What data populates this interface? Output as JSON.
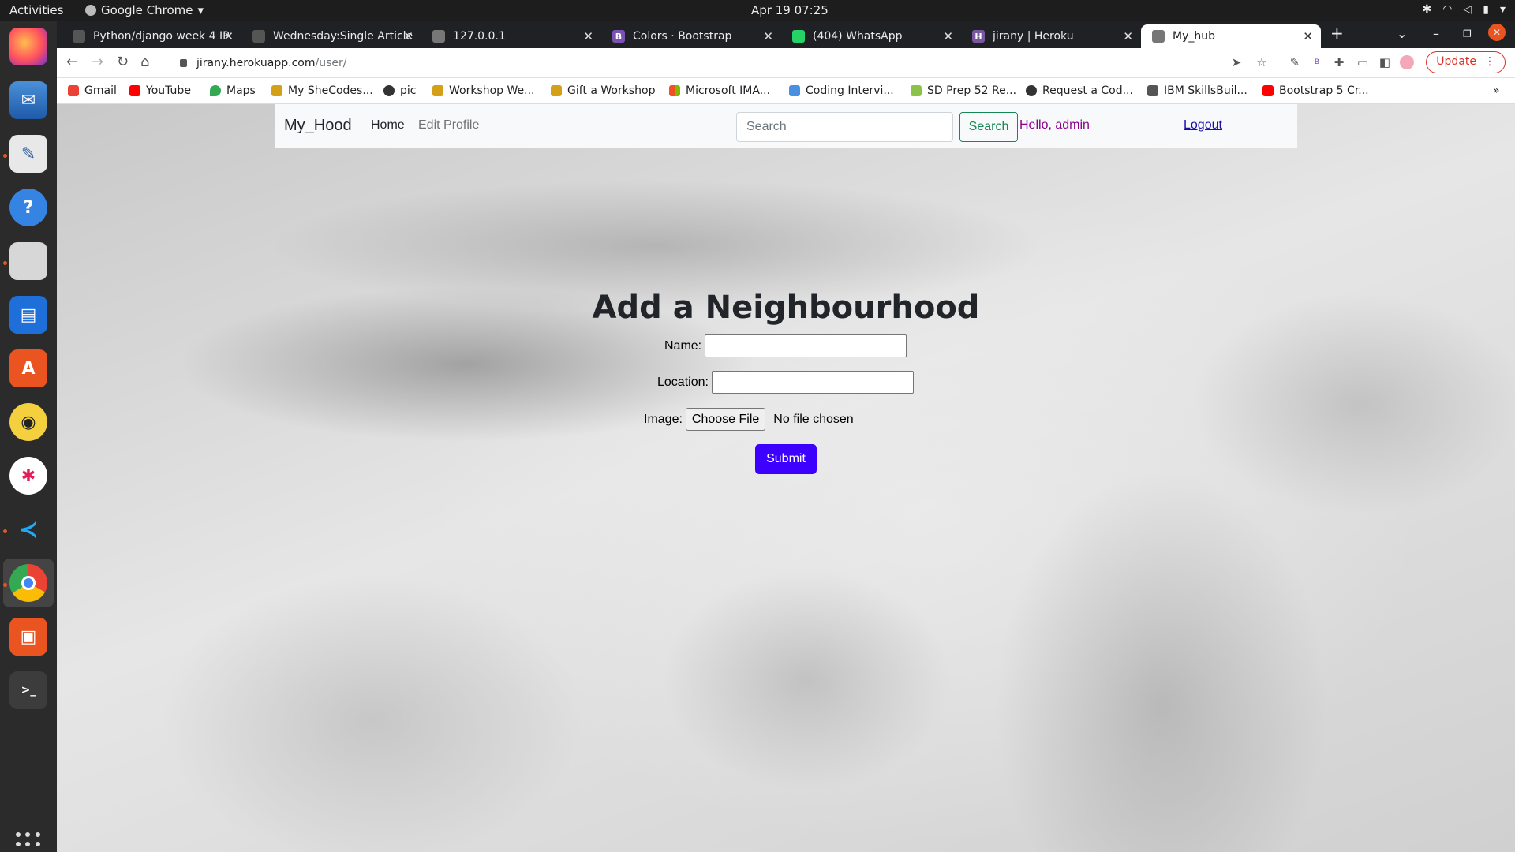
{
  "topbar": {
    "activities": "Activities",
    "app_name": "Google Chrome",
    "datetime": "Apr 19  07:25"
  },
  "dock": {
    "items": [
      "firefox-icon",
      "thunderbird-icon",
      "text-editor-icon",
      "help-icon",
      "files-icon",
      "writer-icon",
      "software-center-icon",
      "rhythmbox-icon",
      "slack-icon",
      "vscode-icon",
      "chrome-icon",
      "impress-icon",
      "terminal-icon"
    ]
  },
  "tabs": [
    {
      "title": "Python/django week 4 IP",
      "favicon_color": "#555555"
    },
    {
      "title": "Wednesday:Single Article",
      "favicon_color": "#555555"
    },
    {
      "title": "127.0.0.1",
      "favicon_color": "#777777"
    },
    {
      "title": "Colors · Bootstrap",
      "favicon_color": "#7952b3"
    },
    {
      "title": "(404) WhatsApp",
      "favicon_color": "#25d366"
    },
    {
      "title": "jirany | Heroku",
      "favicon_color": "#79589f"
    },
    {
      "title": "My_hub",
      "favicon_color": "#777777"
    }
  ],
  "toolbar": {
    "url_host": "jirany.herokuapp.com",
    "url_path": "/user/",
    "update_label": "Update"
  },
  "bookmarks": [
    {
      "label": "Gmail",
      "color": "#ea4335"
    },
    {
      "label": "YouTube",
      "color": "#ff0000"
    },
    {
      "label": "Maps",
      "color": "#34a853"
    },
    {
      "label": "My SheCodes...",
      "color": "#d4a017"
    },
    {
      "label": "pic",
      "color": "#333333"
    },
    {
      "label": "Workshop We...",
      "color": "#d4a017"
    },
    {
      "label": "Gift a Workshop",
      "color": "#d4a017"
    },
    {
      "label": "Microsoft IMA...",
      "color": "#f25022"
    },
    {
      "label": "Coding Intervi...",
      "color": "#4a90e2"
    },
    {
      "label": "SD Prep 52 Re...",
      "color": "#8bc34a"
    },
    {
      "label": "Request a Cod...",
      "color": "#333333"
    },
    {
      "label": "IBM SkillsBuil...",
      "color": "#555555"
    },
    {
      "label": "Bootstrap 5 Cr...",
      "color": "#ff0000"
    }
  ],
  "site": {
    "brand": "My_Hood",
    "nav_home": "Home",
    "nav_edit_profile": "Edit Profile",
    "search_placeholder": "Search",
    "search_button": "Search",
    "greeting": "Hello, admin",
    "logout": "Logout"
  },
  "form": {
    "title": "Add a Neighbourhood",
    "name_label": "Name:",
    "name_value": "",
    "location_label": "Location:",
    "location_value": "",
    "image_label": "Image:",
    "file_button": "Choose File",
    "file_status": "No file chosen",
    "submit": "Submit"
  }
}
